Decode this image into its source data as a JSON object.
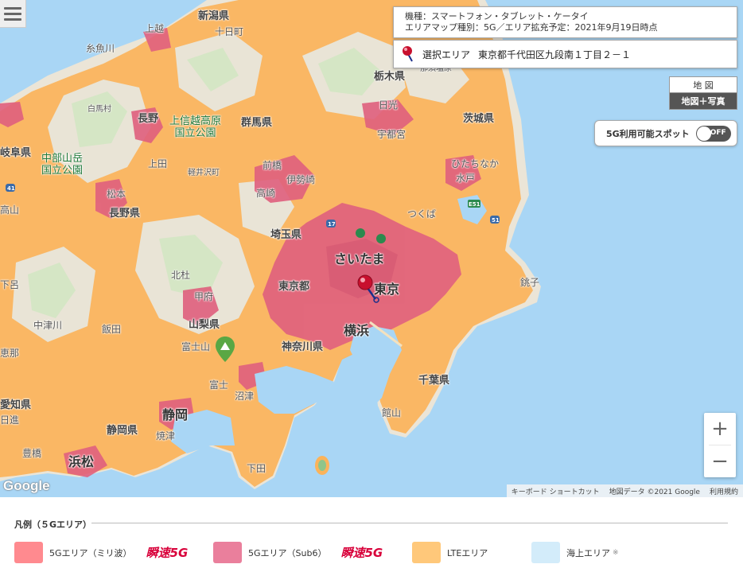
{
  "info": {
    "device_line": "機種：スマートフォン・タブレット・ケータイ",
    "map_type_line": "エリアマップ種別：5G／エリア拡充予定：2021年9月19日時点"
  },
  "selected_area": {
    "label": "選択エリア",
    "address": "東京都千代田区九段南１丁目２－１"
  },
  "map_toggle": {
    "map": "地 図",
    "map_photo": "地図＋写真"
  },
  "spot_button": {
    "label": "5G利用可能スポット",
    "state": "OFF"
  },
  "zoom": {
    "in": "+",
    "out": "−"
  },
  "google_logo": "Google",
  "attribution": {
    "shortcuts": "キーボード ショートカット",
    "map_data": "地図データ ©2021 Google",
    "terms": "利用規約"
  },
  "map_labels": {
    "niigata": "新潟県",
    "tokamachi": "十日町",
    "joetsu": "上越",
    "itoigawa": "糸魚川",
    "hakuba": "白馬村",
    "nagano_city": "長野",
    "joshinetsu_park": "上信越高原\n国立公園",
    "gunma": "群馬県",
    "tochigi": "栃木県",
    "nasushiobara": "那須塩原",
    "nikko": "日光",
    "utsunomiya": "宇都宮",
    "ibaraki": "茨城県",
    "hitachinaka": "ひたちなか",
    "mito": "水戸",
    "chubu_park": "中部山岳\n国立公園",
    "ueda": "上田",
    "karuizawa": "軽井沢町",
    "maebashi": "前橋",
    "isesaki": "伊勢崎",
    "takasaki": "高崎",
    "tsukuba": "つくば",
    "matsumoto": "松本",
    "nagano_pref": "長野県",
    "saitama_pref": "埼玉県",
    "saitama": "さいたま",
    "hokuto": "北杜",
    "tokyo_metro": "東京都",
    "tokyo": "東京",
    "choshi": "銚子",
    "kofu": "甲府",
    "yamanashi": "山梨県",
    "nakatsugawa": "中津川",
    "fujisan": "富士山",
    "kanagawa": "神奈川県",
    "yokohama": "横浜",
    "chiba": "千葉県",
    "fuji": "富士",
    "numazu": "沼津",
    "aichi": "愛知県",
    "shizuoka_city": "静岡",
    "shizuoka_pref": "静岡県",
    "yaizu": "焼津",
    "tateyama": "館山",
    "toyohashi": "豊橋",
    "hamamatsu": "浜松",
    "shimoda": "下田",
    "gifu": "岐阜県",
    "takayama": "高山",
    "shimoro": "下呂",
    "iida": "飯田",
    "ena": "恵那",
    "nisshin": "日進"
  },
  "legend": {
    "title": "凡例（５Gエリア）",
    "items": [
      {
        "label": "5Gエリア（ミリ波）",
        "color": "#ff8a8f",
        "brand": "瞬速5G"
      },
      {
        "label": "5Gエリア（Sub6）",
        "color": "#ea7f9c",
        "brand": "瞬速5G"
      },
      {
        "label": "LTEエリア",
        "color": "#ffc87a",
        "brand": ""
      },
      {
        "label": "海上エリア",
        "color": "#d3ecfa",
        "note": "※"
      }
    ]
  },
  "colors": {
    "sea": "#a9d6f5",
    "lte": "#fbb35a",
    "land": "#e8e3d6",
    "forest": "#cfe3c2",
    "area_5g": "#e0607e",
    "pin": "#c8102e"
  }
}
